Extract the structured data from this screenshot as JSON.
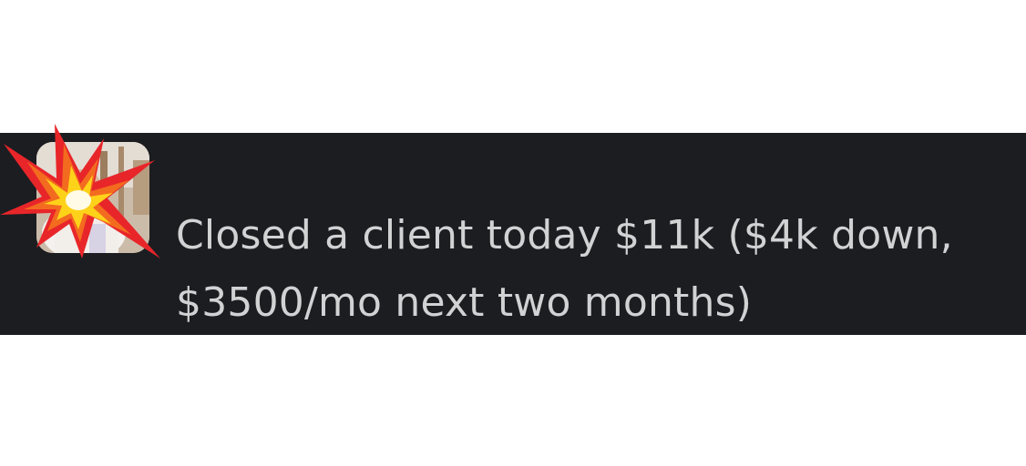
{
  "message": {
    "line1": "Closed a client today $11k ($4k down,",
    "line2": "$3500/mo next two months)"
  },
  "avatar": {
    "icon": "user-photo"
  },
  "reaction": {
    "icon": "collision-burst-emoji"
  },
  "colors": {
    "background": "#1c1d21",
    "text": "#d1d2d3",
    "page": "#ffffff"
  }
}
